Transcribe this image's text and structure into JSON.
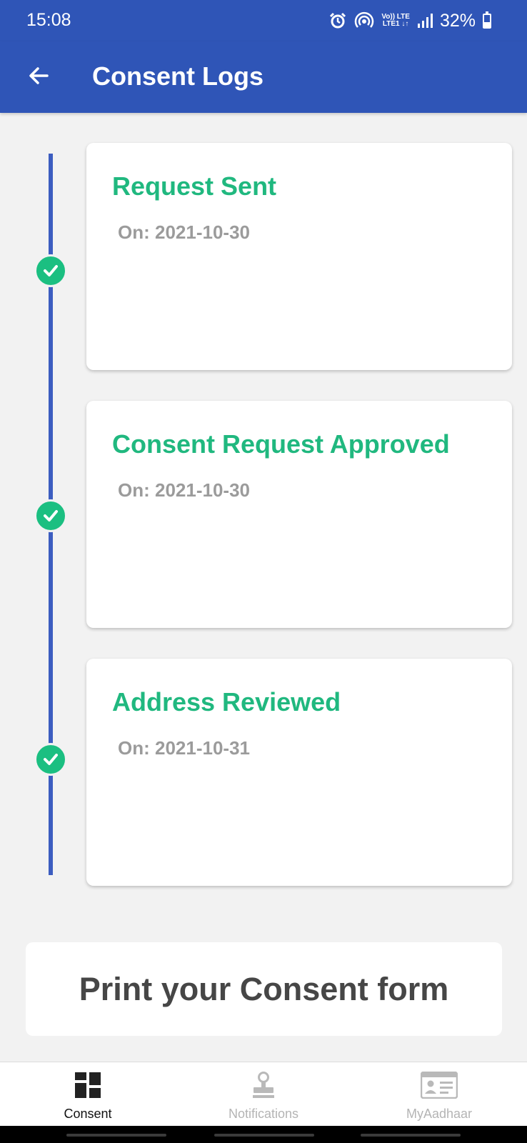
{
  "status_bar": {
    "time": "15:08",
    "net_top": "Vo)) LTE",
    "net_bottom": "LTE1 ↓↑",
    "battery": "32%",
    "icons": [
      "alarm-icon",
      "hotspot-icon",
      "volte-icon",
      "signal-icon",
      "battery-icon"
    ]
  },
  "header": {
    "title": "Consent Logs",
    "back_icon": "arrow-left-icon"
  },
  "timeline": {
    "line_color": "#3c5dc0",
    "check_color": "#1bbf81",
    "events": [
      {
        "title": "Request Sent",
        "date": "On: 2021-10-30"
      },
      {
        "title": "Consent Request Approved",
        "date": "On: 2021-10-30"
      },
      {
        "title": "Address Reviewed",
        "date": "On: 2021-10-31"
      }
    ]
  },
  "print_button": {
    "label": "Print your Consent form"
  },
  "bottom_nav": {
    "active": "Consent",
    "items": [
      {
        "label": "Consent",
        "icon": "dashboard-grid-icon"
      },
      {
        "label": "Notifications",
        "icon": "stamp-icon"
      },
      {
        "label": "MyAadhaar",
        "icon": "id-card-icon"
      }
    ]
  },
  "colors": {
    "primary": "#2f55b7",
    "accent_green": "#20b87f",
    "muted_text": "#9b9b9b",
    "background": "#f2f2f2"
  }
}
